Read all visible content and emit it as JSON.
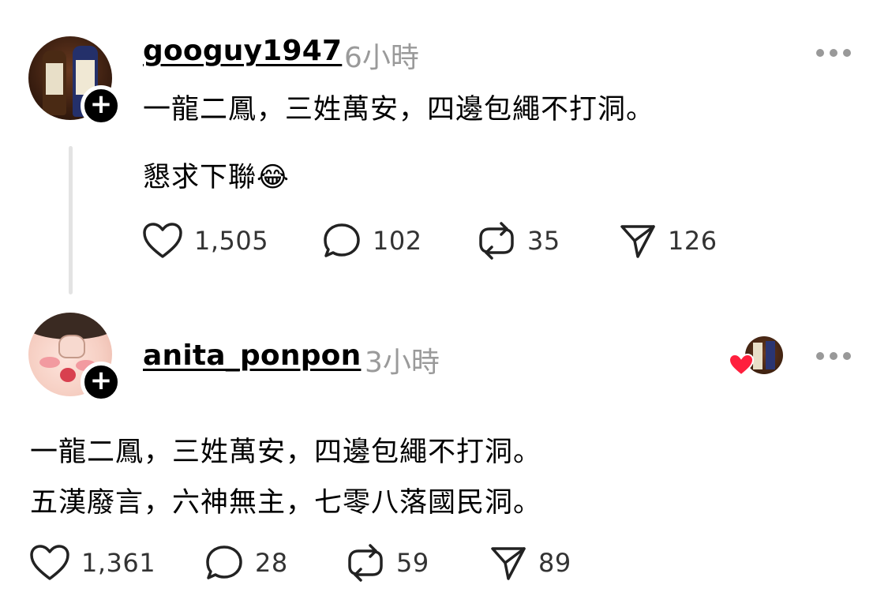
{
  "posts": [
    {
      "username": "googuy1947",
      "time": "6小時",
      "lines": [
        "一龍二鳳，三姓萬安，四邊包繩不打洞。",
        "懇求下聯😂"
      ],
      "likes": "1,505",
      "comments": "102",
      "reposts": "35",
      "shares": "126"
    },
    {
      "username": "anita_ponpon",
      "time": "3小時",
      "lines": [
        "一龍二鳳，三姓萬安，四邊包繩不打洞。",
        "五漢廢言，六神無主，七零八落國民洞。"
      ],
      "likes": "1,361",
      "comments": "28",
      "reposts": "59",
      "shares": "89"
    }
  ],
  "icons": {
    "follow": "+",
    "more": "more-horizontal-icon",
    "like": "heart-icon",
    "comment": "comment-icon",
    "repost": "repost-icon",
    "share": "send-icon",
    "liked_by": "red-heart-icon"
  },
  "colors": {
    "text": "#000000",
    "muted": "#9a9a9a",
    "thread_line": "#e3e3e3",
    "heart_red": "#ff1f3d"
  }
}
